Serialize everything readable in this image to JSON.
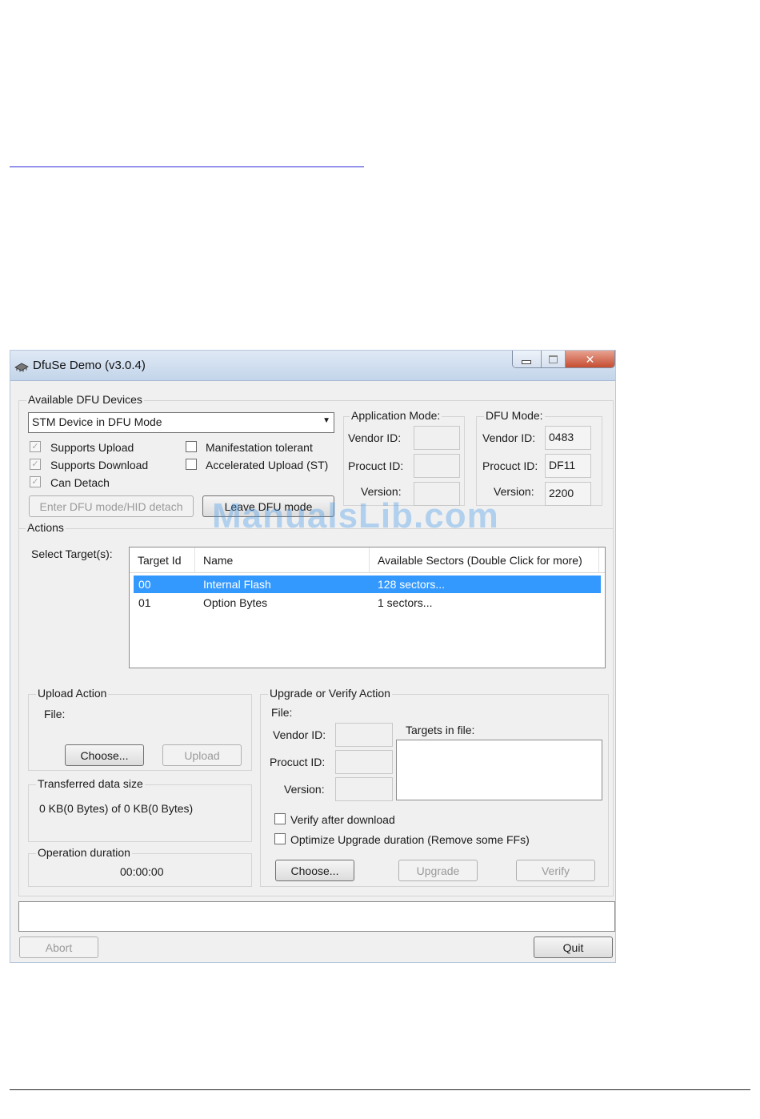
{
  "window": {
    "title": "DfuSe Demo (v3.0.4)"
  },
  "devices": {
    "label": "Available DFU Devices",
    "selected": "STM Device in DFU Mode",
    "supports_upload": "Supports Upload",
    "supports_download": "Supports Download",
    "can_detach": "Can Detach",
    "manifestation_tolerant": "Manifestation tolerant",
    "accelerated_upload": "Accelerated Upload (ST)",
    "enter_dfu_label": "Enter DFU mode/HID detach",
    "leave_dfu_label": "Leave DFU mode"
  },
  "app_mode": {
    "label": "Application Mode:",
    "vendor_label": "Vendor ID:",
    "product_label": "Procuct ID:",
    "version_label": "Version:"
  },
  "dfu_mode": {
    "label": "DFU Mode:",
    "vendor_label": "Vendor ID:",
    "vendor_value": "0483",
    "product_label": "Procuct ID:",
    "product_value": "DF11",
    "version_label": "Version:",
    "version_value": "2200"
  },
  "actions": {
    "label": "Actions",
    "select_target_label": "Select Target(s):",
    "columns": [
      "Target Id",
      "Name",
      "Available Sectors (Double Click for more)"
    ],
    "rows": [
      {
        "id": "00",
        "name": "Internal Flash",
        "sectors": "128 sectors..."
      },
      {
        "id": "01",
        "name": "Option Bytes",
        "sectors": "1 sectors..."
      }
    ]
  },
  "upload": {
    "label": "Upload Action",
    "file_label": "File:",
    "choose_label": "Choose...",
    "upload_label": "Upload"
  },
  "transfer": {
    "label": "Transferred data size",
    "value": "0 KB(0 Bytes) of 0 KB(0 Bytes)"
  },
  "duration": {
    "label": "Operation duration",
    "value": "00:00:00"
  },
  "upgrade": {
    "label": "Upgrade or Verify Action",
    "file_label": "File:",
    "vendor_label": "Vendor ID:",
    "product_label": "Procuct ID:",
    "version_label": "Version:",
    "targets_label": "Targets in file:",
    "verify_after": "Verify after download",
    "optimize": "Optimize Upgrade duration (Remove some FFs)",
    "choose_label": "Choose...",
    "upgrade_label": "Upgrade",
    "verify_label": "Verify"
  },
  "footer": {
    "abort_label": "Abort",
    "quit_label": "Quit"
  },
  "watermark": "ManualsLib.com"
}
